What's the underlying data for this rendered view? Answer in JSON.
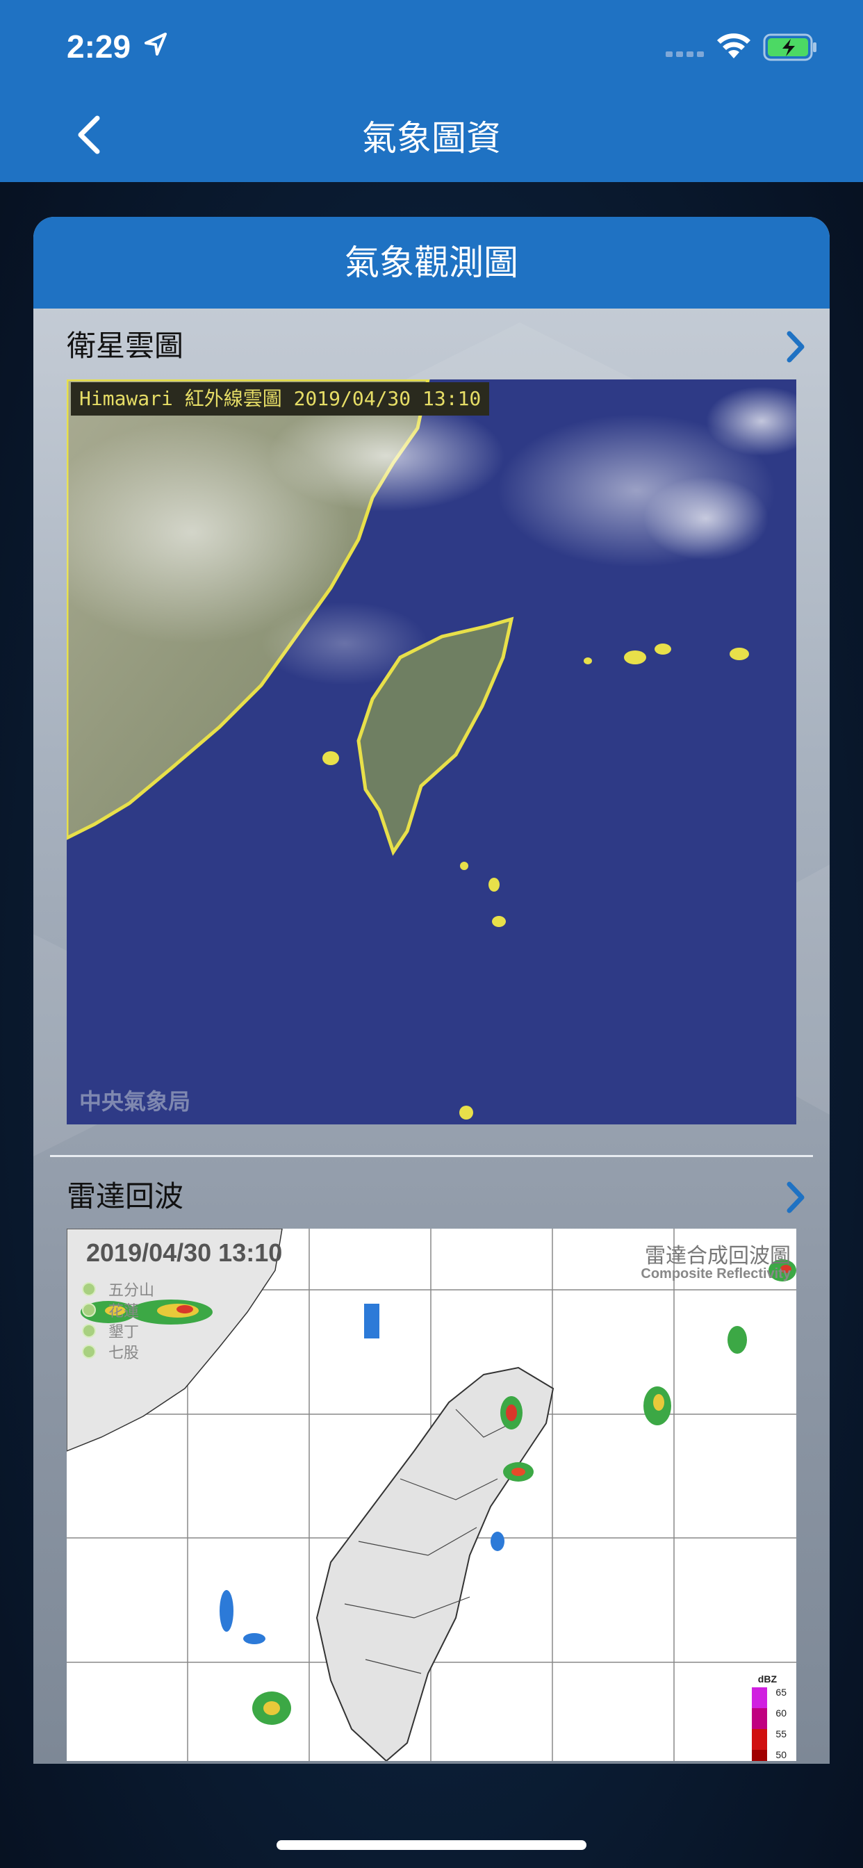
{
  "status_bar": {
    "time": "2:29"
  },
  "nav": {
    "title": "氣象圖資"
  },
  "card": {
    "title": "氣象觀測圖"
  },
  "satellite": {
    "title": "衛星雲圖",
    "caption": "Himawari  紅外線雲圖 2019/04/30  13:10",
    "watermark": "中央氣象局"
  },
  "radar": {
    "title": "雷達回波",
    "date": "2019/04/30  13:10",
    "title_zh": "雷達合成回波圖",
    "title_en": "Composite Reflectivity",
    "stations": [
      "五分山",
      "花蓮",
      "墾丁",
      "七股"
    ],
    "legend": {
      "unit": "dBZ",
      "labels": [
        "65",
        "60",
        "55",
        "50"
      ]
    }
  },
  "colors": {
    "nav_blue": "#1f72c3",
    "ocean": "#2e3a86",
    "coast_yellow": "#e8e04a"
  }
}
